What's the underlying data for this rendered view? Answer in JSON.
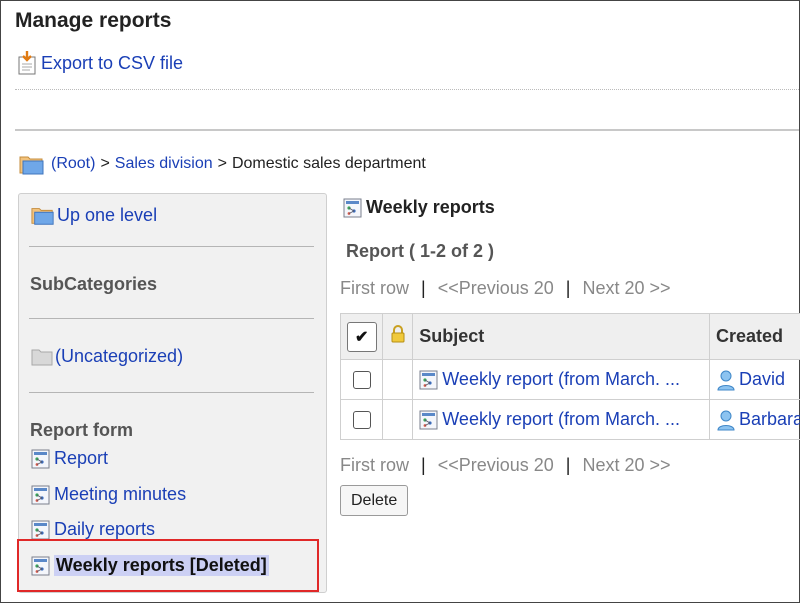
{
  "page": {
    "title": "Manage reports"
  },
  "toolbar": {
    "export_label": "Export to CSV file"
  },
  "breadcrumb": {
    "root": "(Root)",
    "sep1": ">",
    "level1": "Sales division",
    "sep2": ">",
    "current": "Domestic sales department"
  },
  "sidebar": {
    "up_label": "Up one level",
    "subcategories_heading": "SubCategories",
    "uncategorized_label": "(Uncategorized)",
    "report_form_heading": "Report form",
    "forms": [
      {
        "label": "Report"
      },
      {
        "label": "Meeting minutes"
      },
      {
        "label": "Daily reports"
      },
      {
        "label": "Weekly reports [Deleted]",
        "selected": true
      }
    ]
  },
  "main": {
    "title": "Weekly reports",
    "count_text": "Report ( 1-2 of 2 )",
    "pager": {
      "first": "First row",
      "sep": "|",
      "prev": "<<Previous 20",
      "next": "Next 20 >>"
    },
    "columns": {
      "check_all": "✔",
      "subject": "Subject",
      "created": "Created"
    },
    "rows": [
      {
        "subject": "Weekly report (from March. ...",
        "creator": "David"
      },
      {
        "subject": "Weekly report (from March. ...",
        "creator": "Barbara"
      }
    ],
    "delete_label": "Delete"
  },
  "colors": {
    "link": "#1a3fb6",
    "selected_bg": "#ccd0f4",
    "highlight": "#e02828",
    "sidebar_bg": "#f1f1f1"
  },
  "icons": {
    "export": "csv-export-icon",
    "folder": "folder-icon",
    "form": "report-form-icon",
    "lock": "lock-icon",
    "user": "user-icon"
  }
}
